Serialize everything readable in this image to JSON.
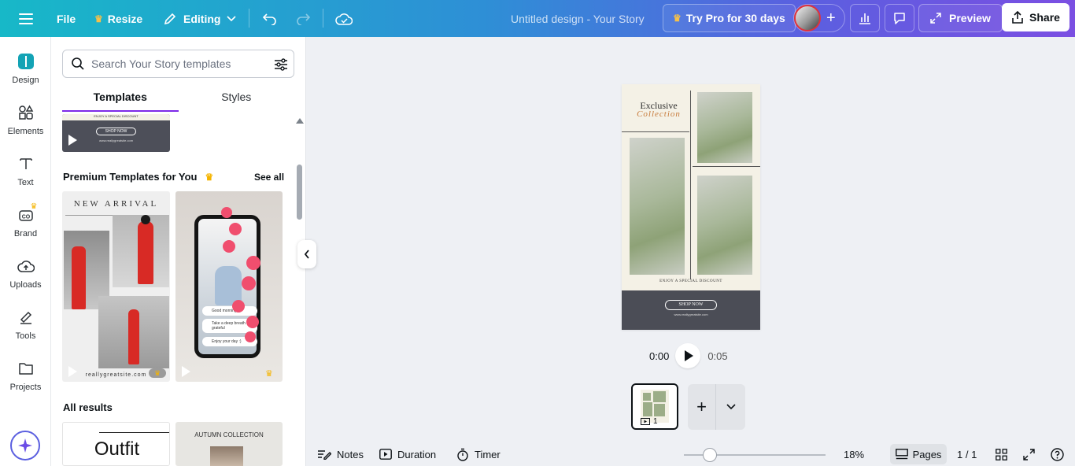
{
  "topbar": {
    "file": "File",
    "resize": "Resize",
    "editing": "Editing",
    "doc_title": "Untitled design - Your Story",
    "try_pro": "Try Pro for 30 days",
    "preview": "Preview",
    "share": "Share"
  },
  "rail": {
    "design": "Design",
    "elements": "Elements",
    "text": "Text",
    "brand": "Brand",
    "uploads": "Uploads",
    "tools": "Tools",
    "projects": "Projects"
  },
  "panel": {
    "search_placeholder": "Search Your Story templates",
    "tab_templates": "Templates",
    "tab_styles": "Styles",
    "top_thumb_line1": "ENJOY A SPECIAL DISCOUNT",
    "top_thumb_cta": "SHOP NOW",
    "top_thumb_url": "www.reallygreatsite.com",
    "premium_heading": "Premium Templates for You",
    "see_all": "See all",
    "t1_title": "NEW ARRIVAL",
    "t1_url": "reallygreatsite.com",
    "t2_chat1": "Good morning",
    "t2_chat2": "Take a deep breath be grateful",
    "t2_chat3": "Enjoy your day :)",
    "all_results": "All results",
    "r1_title": "Outfit",
    "r2_title": "AUTUMN COLLECTION"
  },
  "canvas": {
    "title_line1": "Exclusive",
    "title_line2": "Collection",
    "discount": "ENJOY A SPECIAL DISCOUNT",
    "cta": "SHOP NOW",
    "url": "www.reallygreatsite.com",
    "time_current": "0:00",
    "time_total": "0:05",
    "page_number": "1"
  },
  "bottombar": {
    "notes": "Notes",
    "duration": "Duration",
    "timer": "Timer",
    "zoom": "18%",
    "zoom_level": 0.18,
    "pages": "Pages",
    "page_count": "1 / 1"
  },
  "colors": {
    "accent_purple": "#7d2ae8",
    "canvas_footer": "#4b4d56",
    "collection_script": "#c77a3a"
  }
}
